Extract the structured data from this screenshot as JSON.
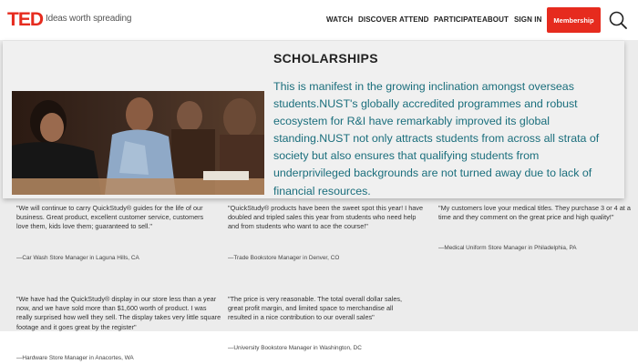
{
  "header": {
    "logo": "TED",
    "tagline": "Ideas worth spreading",
    "nav": [
      "WATCH",
      "DISCOVER",
      "ATTEND",
      "PARTICIPATE",
      "ABOUT",
      "SIGN IN"
    ],
    "membership_label": "Membership",
    "search_icon": "search-icon"
  },
  "scholarship": {
    "title": "SCHOLARSHIPS",
    "body": "This is manifest in the growing inclination amongst overseas students.NUST's globally accredited programmes and robust ecosystem for R&I have remarkably improved its global standing.NUST not only attracts students from across all strata of society but also ensures that qualifying students from underprivileged backgrounds are not turned away due to lack of financial resources."
  },
  "testimonials": [
    {
      "quote": "\"We will continue to carry QuickStudy® guides for the life of our business. Great product, excellent customer service, customers love them, kids love them; guaranteed to sell.\"",
      "attribution": "—Car Wash Store Manager in Laguna Hills, CA"
    },
    {
      "quote": "\"QuickStudy® products have been the sweet spot this year! I have doubled and tripled sales this year from students who need help and from students who want to ace the course!\"",
      "attribution": "—Trade Bookstore Manager in Denver, CO"
    },
    {
      "quote": "\"My customers love your medical titles. They purchase 3 or 4 at a time and they comment on the great price and high quality!\"",
      "attribution": "—Medical Uniform Store Manager in Philadelphia, PA"
    },
    {
      "quote": "\"We have had the QuickStudy® display in our store less than a year now, and we have sold more than $1,600 worth of product. I was really surprised how well they sell. The display takes very little square footage and it goes great by the register\"",
      "attribution": "—Hardware Store Manager in Anacortes, WA"
    },
    {
      "quote": "\"The price is very reasonable. The total overall dollar sales, great profit margin, and limited space to merchandise all resulted in a nice contribution to our overall sales\"",
      "attribution": "—University Bookstore Manager in Washington, DC"
    }
  ],
  "colors": {
    "brand_red": "#e62b1e",
    "body_teal": "#1a6e7c",
    "band_grey": "#ececec"
  }
}
